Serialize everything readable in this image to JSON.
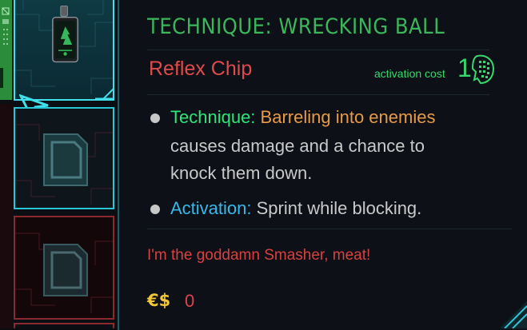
{
  "tooltip": {
    "title": "TECHNIQUE: WRECKING BALL",
    "item_type": "Reflex Chip",
    "activation_cost_label": "activation cost",
    "activation_cost_value": "1",
    "effects": [
      {
        "keyword": "Technique:",
        "highlight": "Barreling into enemies",
        "text_line1_rest": "",
        "text_line2": "causes damage and a chance to",
        "text_line3": "knock them down."
      },
      {
        "keyword": "Activation:",
        "text": "Sprint while blocking."
      }
    ],
    "flavor_text": "I'm the goddamn Smasher, meat!",
    "price_icon": "€$",
    "price_value": "0"
  },
  "slots": [
    {
      "state": "equipped",
      "icon": "reflex-chip-icon"
    },
    {
      "state": "empty",
      "icon": "empty-chip-slot-icon"
    },
    {
      "state": "empty",
      "icon": "empty-chip-slot-icon"
    }
  ],
  "colors": {
    "title": "#3bb65a",
    "item_type": "#e04a4a",
    "accent_cyan": "#27c7d8",
    "keyword_green": "#2ee57a",
    "keyword_blue": "#35b9ea",
    "highlight_orange": "#e79a47",
    "price_yellow": "#f0c63a"
  }
}
